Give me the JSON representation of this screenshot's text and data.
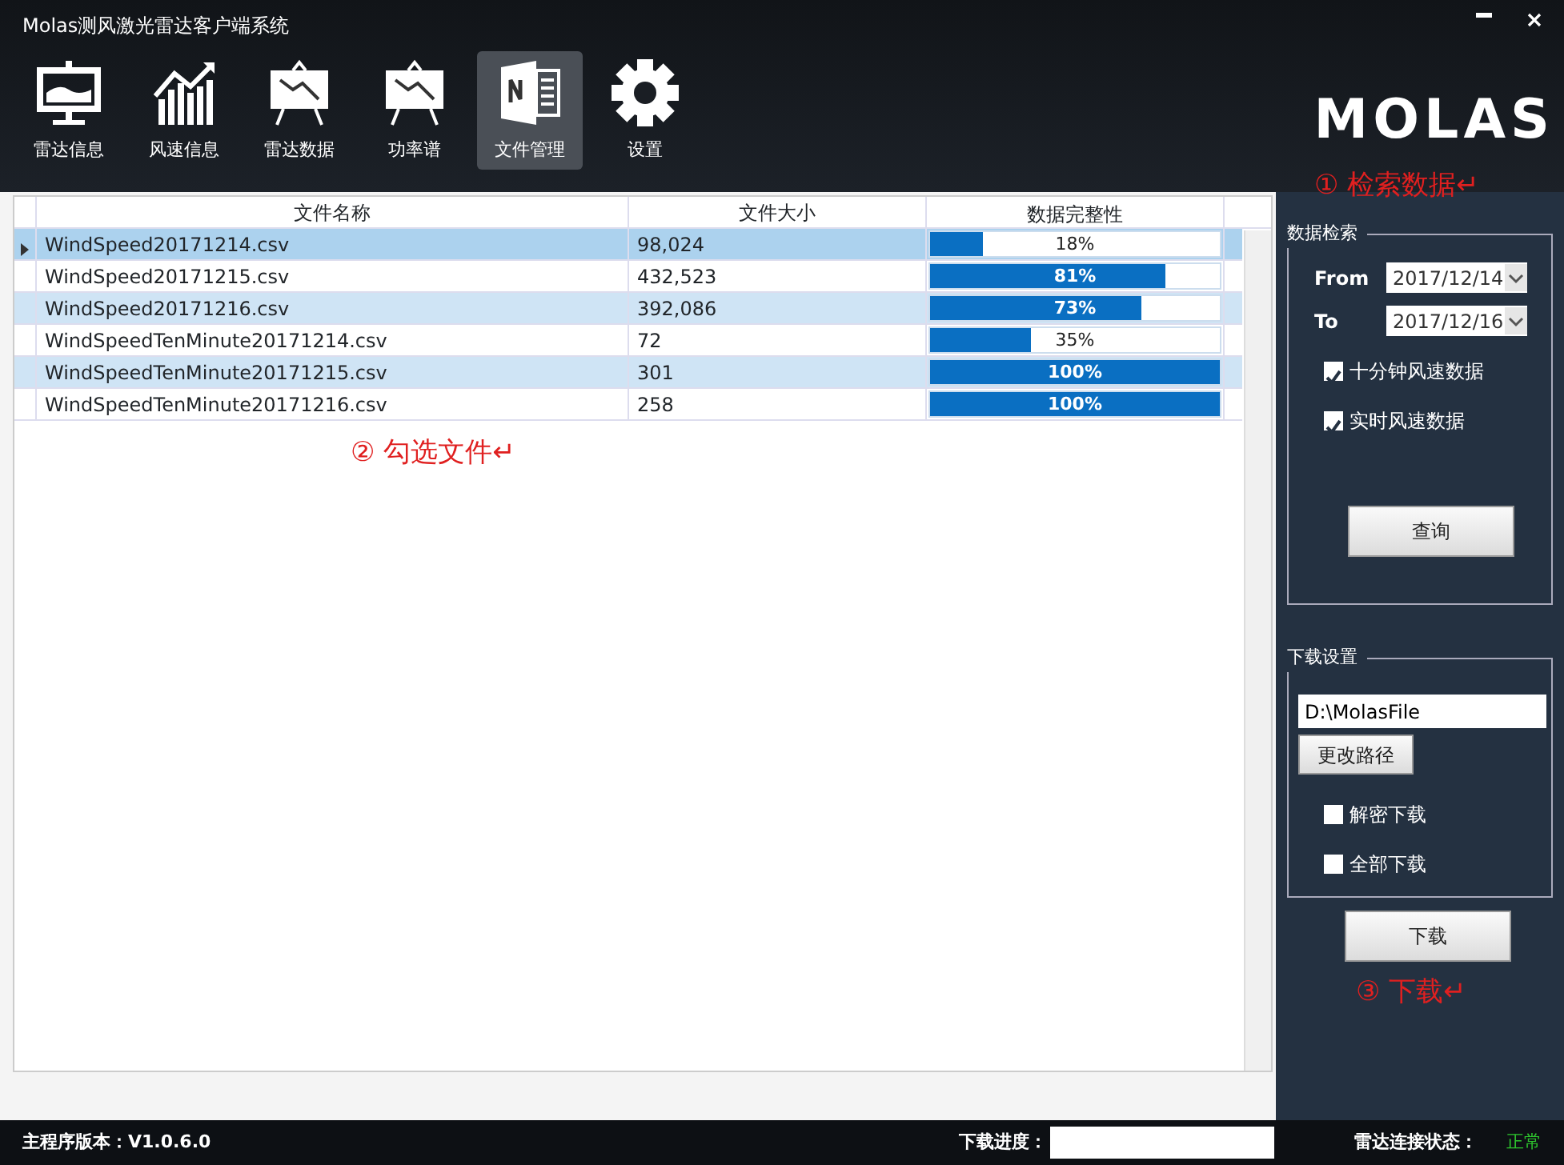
{
  "window": {
    "title": "Molas测风激光雷达客户端系统"
  },
  "toolbar": [
    {
      "label": "雷达信息",
      "selected": false
    },
    {
      "label": "风速信息",
      "selected": false
    },
    {
      "label": "雷达数据",
      "selected": false
    },
    {
      "label": "功率谱",
      "selected": false
    },
    {
      "label": "文件管理",
      "selected": true
    },
    {
      "label": "设置",
      "selected": false
    }
  ],
  "logo": "MOLAS",
  "table": {
    "columns": [
      "文件名称",
      "文件大小",
      "数据完整性"
    ],
    "rows": [
      {
        "name": "WindSpeed20171214.csv",
        "size": "98,024",
        "level": 0.18,
        "reading": "18%",
        "selected": true
      },
      {
        "name": "WindSpeed20171215.csv",
        "size": "432,523",
        "level": 0.81,
        "reading": "81%",
        "selected": false
      },
      {
        "name": "WindSpeed20171216.csv",
        "size": "392,086",
        "level": 0.73,
        "reading": "73%",
        "selected": false
      },
      {
        "name": "WindSpeedTenMinute20171214.csv",
        "size": "72",
        "level": 0.35,
        "reading": "35%",
        "selected": false
      },
      {
        "name": "WindSpeedTenMinute20171215.csv",
        "size": "301",
        "level": 1,
        "reading": "100%",
        "selected": false
      },
      {
        "name": "WindSpeedTenMinute20171216.csv",
        "size": "258",
        "level": 1,
        "reading": "100%",
        "selected": false
      }
    ]
  },
  "annotations": [
    "① 检索数据↵",
    "② 勾选文件↵",
    "③ 下载↵"
  ],
  "search": {
    "title": "数据检索",
    "from_label": "From",
    "from": "2017/12/14",
    "to_label": "To",
    "to": "2017/12/16",
    "options": [
      {
        "label": "十分钟风速数据",
        "checked": true
      },
      {
        "label": "实时风速数据",
        "checked": true
      }
    ],
    "button": "查询"
  },
  "download": {
    "title": "下载设置",
    "path": "D:\\MolasFile",
    "change_button": "更改路径",
    "options": [
      {
        "label": "解密下载",
        "checked": false
      },
      {
        "label": "全部下载",
        "checked": false
      }
    ],
    "button": "下载"
  },
  "status_bar": {
    "version": "主程序版本：V1.0.6.0",
    "progress_label": "下载进度：",
    "radar_label": "雷达连接状态：",
    "radar_status": "正常"
  }
}
